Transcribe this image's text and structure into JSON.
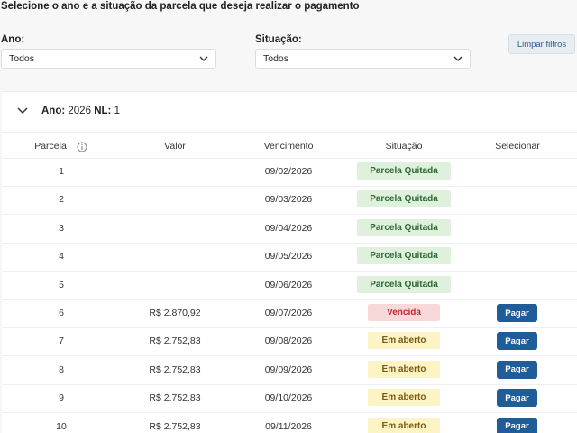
{
  "headline": "Selecione o ano e a situação da parcela que deseja realizar o pagamento",
  "filters": {
    "year_label": "Ano:",
    "year_value": "Todos",
    "status_label": "Situação:",
    "status_value": "Todos",
    "clear_label": "Limpar filtros"
  },
  "group": {
    "year_label": "Ano:",
    "year_value": "2026",
    "nl_label": "NL:",
    "nl_value": "1"
  },
  "columns": {
    "parcela": "Parcela",
    "valor": "Valor",
    "vencimento": "Vencimento",
    "situacao": "Situação",
    "selecionar": "Selecionar"
  },
  "rows": [
    {
      "parcela": "1",
      "valor": "",
      "vencimento": "09/02/2026",
      "situacao": "Parcela Quitada",
      "status": "paid",
      "action": ""
    },
    {
      "parcela": "2",
      "valor": "",
      "vencimento": "09/03/2026",
      "situacao": "Parcela Quitada",
      "status": "paid",
      "action": ""
    },
    {
      "parcela": "3",
      "valor": "",
      "vencimento": "09/04/2026",
      "situacao": "Parcela Quitada",
      "status": "paid",
      "action": ""
    },
    {
      "parcela": "4",
      "valor": "",
      "vencimento": "09/05/2026",
      "situacao": "Parcela Quitada",
      "status": "paid",
      "action": ""
    },
    {
      "parcela": "5",
      "valor": "",
      "vencimento": "09/06/2026",
      "situacao": "Parcela Quitada",
      "status": "paid",
      "action": ""
    },
    {
      "parcela": "6",
      "valor": "R$ 2.870,92",
      "vencimento": "09/07/2026",
      "situacao": "Vencida",
      "status": "late",
      "action": "Pagar"
    },
    {
      "parcela": "7",
      "valor": "R$ 2.752,83",
      "vencimento": "09/08/2026",
      "situacao": "Em aberto",
      "status": "open",
      "action": "Pagar"
    },
    {
      "parcela": "8",
      "valor": "R$ 2.752,83",
      "vencimento": "09/09/2026",
      "situacao": "Em aberto",
      "status": "open",
      "action": "Pagar"
    },
    {
      "parcela": "9",
      "valor": "R$ 2.752,83",
      "vencimento": "09/10/2026",
      "situacao": "Em aberto",
      "status": "open",
      "action": "Pagar"
    },
    {
      "parcela": "10",
      "valor": "R$ 2.752,83",
      "vencimento": "09/11/2026",
      "situacao": "Em aberto",
      "status": "open",
      "action": "Pagar"
    }
  ],
  "icons": {
    "select_chevron": "chevron-down-icon",
    "group_toggle": "chevron-down-icon",
    "parcela_info": "info-icon"
  },
  "colors": {
    "pay_button": "#1f5d99",
    "paid_bg": "#dff0dc",
    "paid_text": "#2d6a34",
    "late_bg": "#f8d9da",
    "late_text": "#c1272d",
    "open_bg": "#fcf4c4",
    "open_text": "#7a5a12"
  }
}
